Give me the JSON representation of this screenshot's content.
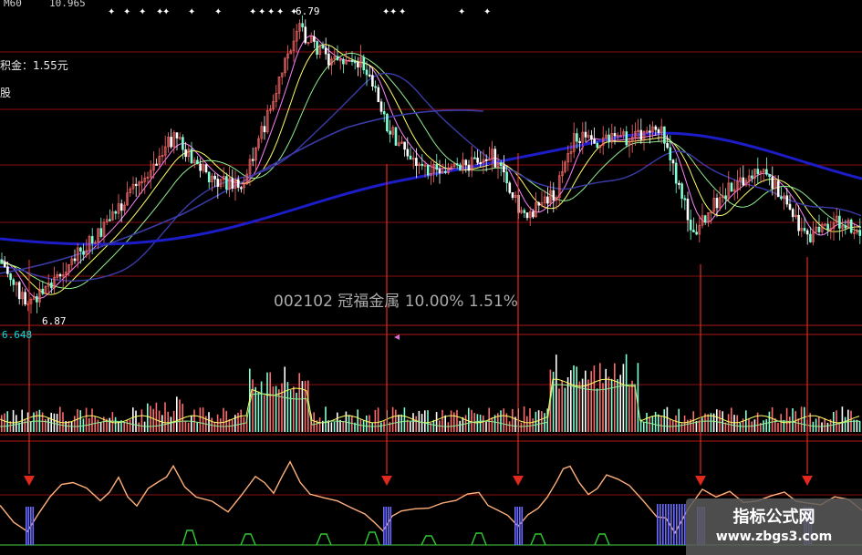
{
  "header": {
    "ma_label": "M60",
    "ma_value": "10.965"
  },
  "price_panel": {
    "accumulation_label": "积金：1.55元",
    "side_label": "股",
    "high_label": "6.79",
    "low_label": "6.87",
    "volume_scale_label": "6.648",
    "stock_line": "002102 冠福金属 10.00% 1.51%"
  },
  "watermark": {
    "title": "指标公式网",
    "url": "www.zbgs3.com"
  },
  "colors": {
    "background": "#000000",
    "up_candle": "#ff6a6a",
    "down_candle": "#7fffd4",
    "ma_long": "#1c1cc8",
    "ma_mid": "#3b3ba8",
    "ma_short": "#90ee90",
    "oscillator": "#ffb07a",
    "signal_arrow": "#e0281e",
    "panel_line": "#8a1010",
    "signal_bar": "#6a6aff"
  },
  "chart_data": {
    "type": "candlestick",
    "title": "",
    "price_high": 6.79,
    "price_low": 6.87,
    "signal_points": [
      32,
      424,
      568,
      768,
      885
    ],
    "panels": [
      "price",
      "volume",
      "oscillator"
    ]
  }
}
